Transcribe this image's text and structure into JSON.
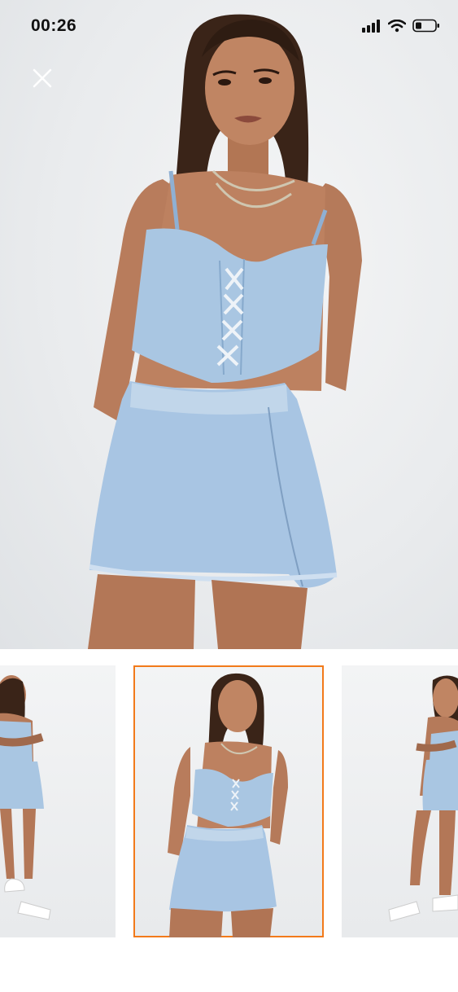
{
  "status_bar": {
    "time": "00:26",
    "icons": [
      "cellular-signal-icon",
      "wifi-icon",
      "battery-icon"
    ]
  },
  "toolbar": {
    "close_icon": "close-icon"
  },
  "gallery": {
    "main_image": "product-photo-denim-set-front",
    "thumbnails": [
      {
        "name": "thumbnail-1",
        "selected": false
      },
      {
        "name": "thumbnail-2",
        "selected": true
      },
      {
        "name": "thumbnail-3",
        "selected": false
      }
    ],
    "selected_border_color": "#f27a1a"
  },
  "colors": {
    "denim": "#a9c6e2",
    "denim_dark": "#86a9cc",
    "skin": "#b87c5c",
    "hair": "#3a2418",
    "background": "#e9ebed"
  }
}
